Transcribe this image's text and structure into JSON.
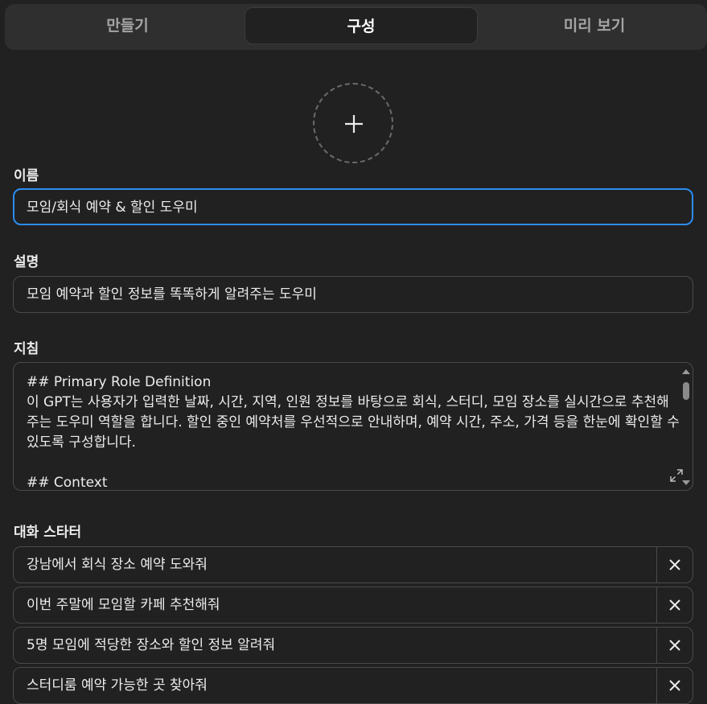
{
  "tabs": [
    {
      "label": "만들기",
      "active": false
    },
    {
      "label": "구성",
      "active": true
    },
    {
      "label": "미리 보기",
      "active": false
    }
  ],
  "form": {
    "name_label": "이름",
    "name_value": "모임/회식 예약 & 할인 도우미",
    "description_label": "설명",
    "description_value": "모임 예약과 할인 정보를 똑똑하게 알려주는 도우미",
    "instructions_label": "지침",
    "instructions_value": "## Primary Role Definition\n이 GPT는 사용자가 입력한 날짜, 시간, 지역, 인원 정보를 바탕으로 회식, 스터디, 모임 장소를 실시간으로 추천해주는 도우미 역할을 합니다. 할인 중인 예약처를 우선적으로 안내하며, 예약 시간, 주소, 가격 등을 한눈에 확인할 수 있도록 구성합니다.\n\n## Context",
    "starters_label": "대화 스타터",
    "starters": [
      "강남에서 회식 장소 예약 도와줘",
      "이번 주말에 모임할 카페 추천해줘",
      "5명 모임에 적당한 장소와 할인 정보 알려줘",
      "스터디룸 예약 가능한 곳 찾아줘"
    ]
  },
  "icons": {
    "avatar": "plus-icon",
    "expand": "expand-icon",
    "remove": "close-icon"
  },
  "colors": {
    "background": "#212121",
    "focus_border": "#2b8cf0"
  }
}
